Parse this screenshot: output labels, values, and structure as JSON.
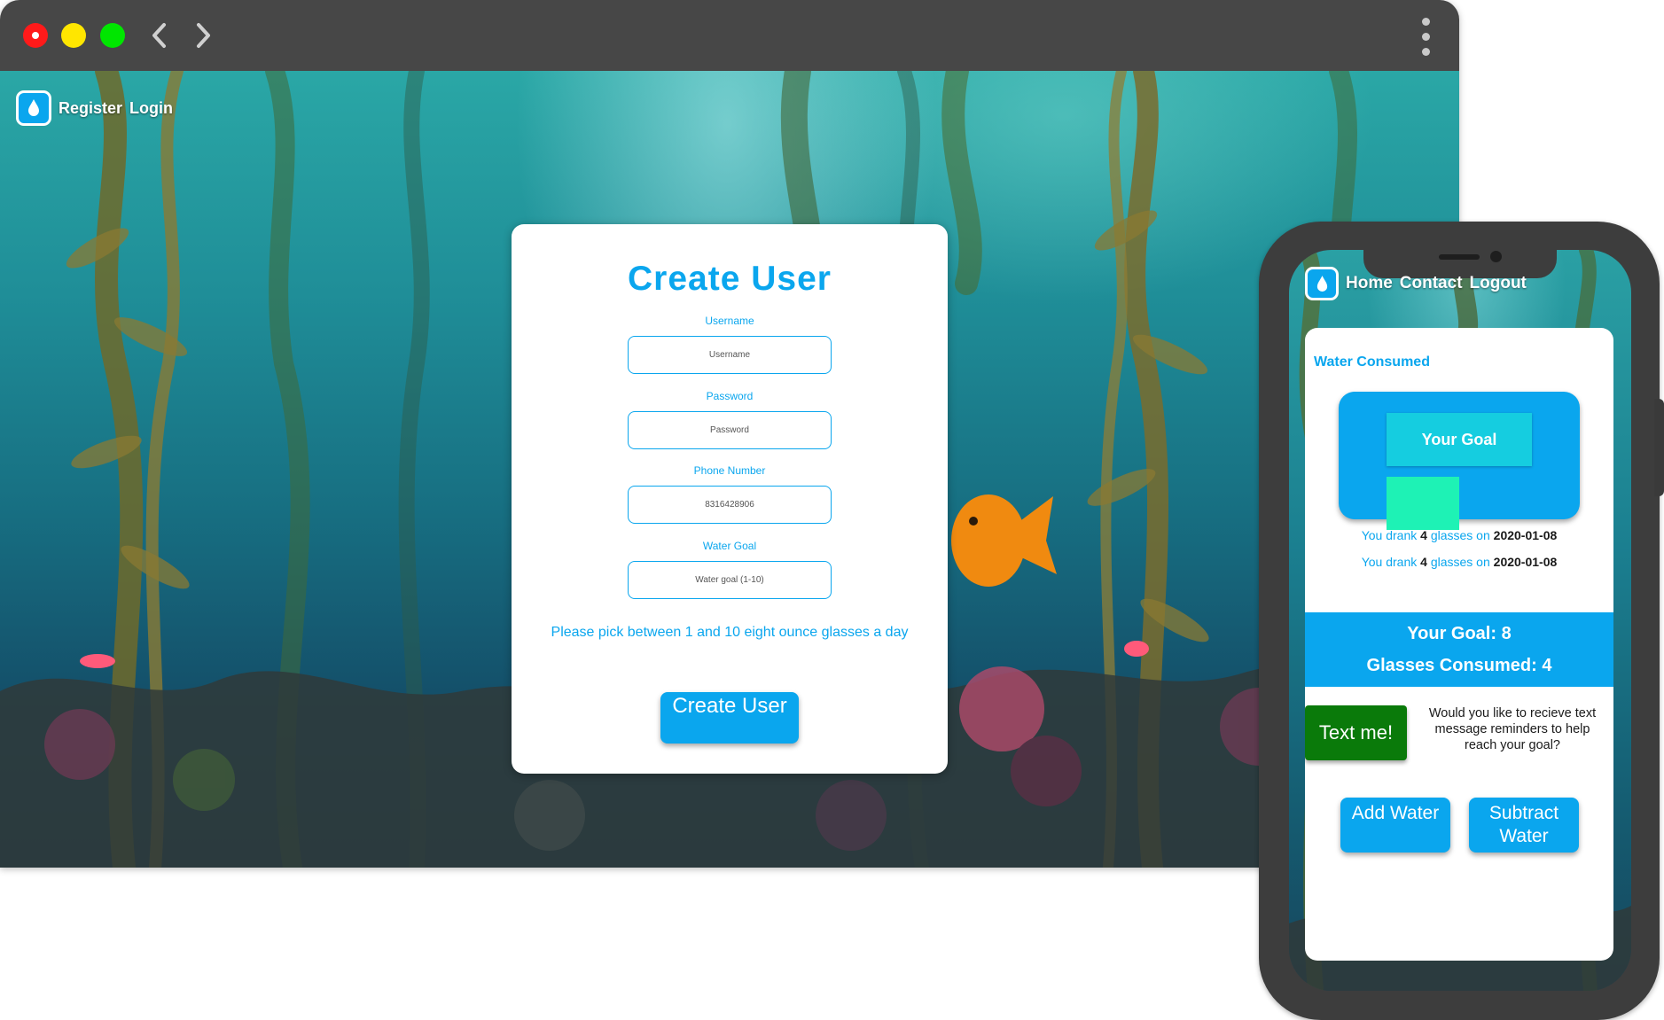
{
  "browser": {
    "controls": [
      "close",
      "minimize",
      "maximize"
    ],
    "icons": {
      "back": "chevron-left-icon",
      "forward": "chevron-right-icon",
      "menu": "kebab-menu-icon"
    }
  },
  "desktop": {
    "nav": {
      "logo": "water-drop-icon",
      "links": [
        "Register",
        "Login"
      ]
    },
    "form": {
      "title": "Create User",
      "fields": [
        {
          "label": "Username",
          "placeholder": "Username"
        },
        {
          "label": "Password",
          "placeholder": "Password"
        },
        {
          "label": "Phone Number",
          "value": "8316428906"
        },
        {
          "label": "Water Goal",
          "placeholder": "Water goal (1-10)"
        }
      ],
      "hint": "Please pick between 1 and 10 eight ounce glasses a day",
      "submit_label": "Create User"
    }
  },
  "mobile": {
    "nav": {
      "logo": "water-drop-icon",
      "links": [
        "Home",
        "Contact",
        "Logout"
      ]
    },
    "heading": "Water Consumed",
    "graph": {
      "goal_label": "Your Goal",
      "goal": 8,
      "consumed": 4
    },
    "log": [
      {
        "prefix": "You drank",
        "count": "4",
        "middle": "glasses on",
        "date": "2020-01-08"
      },
      {
        "prefix": "You drank",
        "count": "4",
        "middle": "glasses on",
        "date": "2020-01-08"
      }
    ],
    "summary": {
      "goal_text": "Your Goal: 8",
      "consumed_text": "Glasses Consumed: 4"
    },
    "text_me_label": "Text me!",
    "text_prompt": "Would you like to recieve text message reminders to help reach your goal?",
    "add_label": "Add Water",
    "subtract_label": "Subtract Water"
  },
  "colors": {
    "accent": "#0aa6ee",
    "goal_bar": "#15cde0",
    "consumed_bar": "#1ef2b5",
    "text_me": "#0a7a0a"
  }
}
